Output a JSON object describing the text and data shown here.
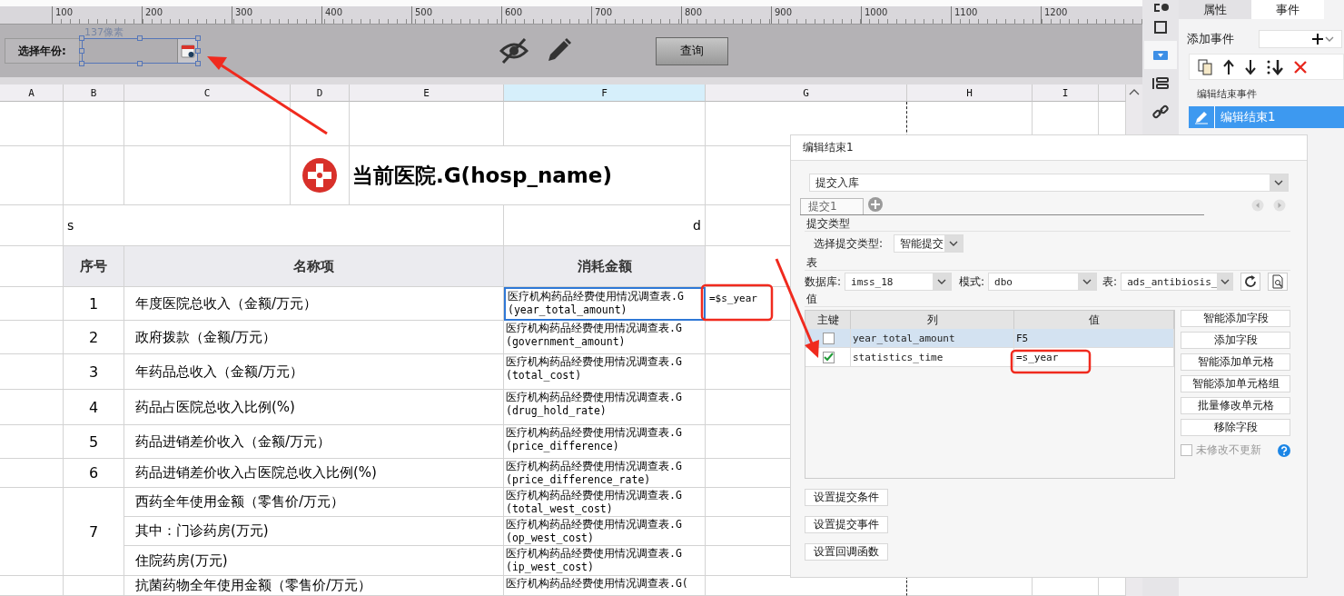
{
  "ruler": {
    "ticks": [
      "100",
      "200",
      "300",
      "400",
      "500",
      "600",
      "700",
      "800",
      "900",
      "1000",
      "1100",
      "1200"
    ]
  },
  "parameter_panel": {
    "year_label": "选择年份:",
    "year_field": {
      "size_hint": "137像素",
      "selected": true
    },
    "query_button": "查询"
  },
  "sheet": {
    "columns": [
      {
        "label": "A",
        "selected": false
      },
      {
        "label": "B",
        "selected": false
      },
      {
        "label": "C",
        "selected": false
      },
      {
        "label": "D",
        "selected": false
      },
      {
        "label": "E",
        "selected": false
      },
      {
        "label": "F",
        "selected": true
      },
      {
        "label": "G",
        "selected": false
      },
      {
        "label": "H",
        "selected": false
      },
      {
        "label": "I",
        "selected": false
      }
    ],
    "title": "当前医院.G(hosp_name)",
    "left_note": "s",
    "right_note": "d",
    "headers": [
      "序号",
      "名称项",
      "消耗金额"
    ],
    "rows": [
      {
        "number": "1",
        "lines": [
          {
            "name": "年度医院总收入（金额/万元）",
            "formula": "医疗机构药品经费使用情况调查表.G(year_total_amount)",
            "column_g": "=$s_year",
            "selected": true
          }
        ]
      },
      {
        "number": "2",
        "lines": [
          {
            "name": "政府拨款（金额/万元）",
            "formula": "医疗机构药品经费使用情况调查表.G(government_amount)",
            "selected": false
          }
        ]
      },
      {
        "number": "3",
        "lines": [
          {
            "name": "年药品总收入（金额/万元）",
            "formula": "医疗机构药品经费使用情况调查表.G(total_cost)",
            "selected": false
          }
        ]
      },
      {
        "number": "4",
        "lines": [
          {
            "name": "药品占医院总收入比例(%)",
            "formula": "医疗机构药品经费使用情况调查表.G(drug_hold_rate)",
            "selected": false
          }
        ]
      },
      {
        "number": "5",
        "lines": [
          {
            "name": "药品进销差价收入（金额/万元）",
            "formula": "医疗机构药品经费使用情况调查表.G(price_difference)",
            "selected": false
          }
        ]
      },
      {
        "number": "6",
        "lines": [
          {
            "name": "药品进销差价收入占医院总收入比例(%)",
            "formula": "医疗机构药品经费使用情况调查表.G(price_difference_rate)",
            "selected": false
          }
        ]
      },
      {
        "number": "7",
        "lines": [
          {
            "name": "西药全年使用金额（零售价/万元）",
            "formula": "医疗机构药品经费使用情况调查表.G(total_west_cost)",
            "selected": false
          },
          {
            "name": "其中：门诊药房(万元)",
            "formula": "医疗机构药品经费使用情况调查表.G(op_west_cost)",
            "selected": false
          },
          {
            "name": "住院药房(万元)",
            "formula": "医疗机构药品经费使用情况调查表.G(ip_west_cost)",
            "selected": false
          }
        ]
      },
      {
        "lines": [
          {
            "name": "抗菌药物全年使用金额（零售价/万元）",
            "formula": "医疗机构药品经费使用情况调查表.G(",
            "selected": false
          }
        ]
      }
    ]
  },
  "side_tools": [
    {
      "selected": false
    },
    {
      "selected": false
    },
    {
      "selected": true
    },
    {
      "selected": false
    },
    {
      "selected": false
    }
  ],
  "event_panel": {
    "tabs": [
      {
        "label": "属性",
        "selected": false
      },
      {
        "label": "事件",
        "selected": true
      }
    ],
    "add_event_label": "添加事件",
    "group_label": "编辑结束事件",
    "events": [
      {
        "label": "编辑结束1",
        "selected": true
      }
    ]
  },
  "dialog": {
    "title": "编辑结束1",
    "action": "提交入库",
    "tabs": [
      {
        "label": "提交1",
        "selected": true
      }
    ],
    "submit_type_section": "提交类型",
    "submit_type_label": "选择提交类型:",
    "submit_type": "智能提交",
    "table_section": "表",
    "database_label": "数据库:",
    "database": "imss_18",
    "schema_label": "模式:",
    "schema": "dbo",
    "table_label": "表:",
    "table": "ads_antibiosis_",
    "value_section": "值",
    "grid": {
      "columns": [
        "主键",
        "列",
        "值"
      ],
      "rows": [
        {
          "key": false,
          "column": "year_total_amount",
          "value": "F5",
          "selected": true
        },
        {
          "key": true,
          "column": "statistics_time",
          "value": "=s_year",
          "selected": false
        }
      ]
    },
    "side_buttons": [
      "智能添加字段",
      "添加字段",
      "智能添加单元格",
      "智能添加单元格组",
      "批量修改单元格",
      "移除字段"
    ],
    "skip_unchanged": {
      "label": "未修改不更新",
      "checked": false,
      "disabled": true
    },
    "bottom_buttons": [
      "设置提交条件",
      "设置提交事件",
      "设置回调函数"
    ]
  }
}
